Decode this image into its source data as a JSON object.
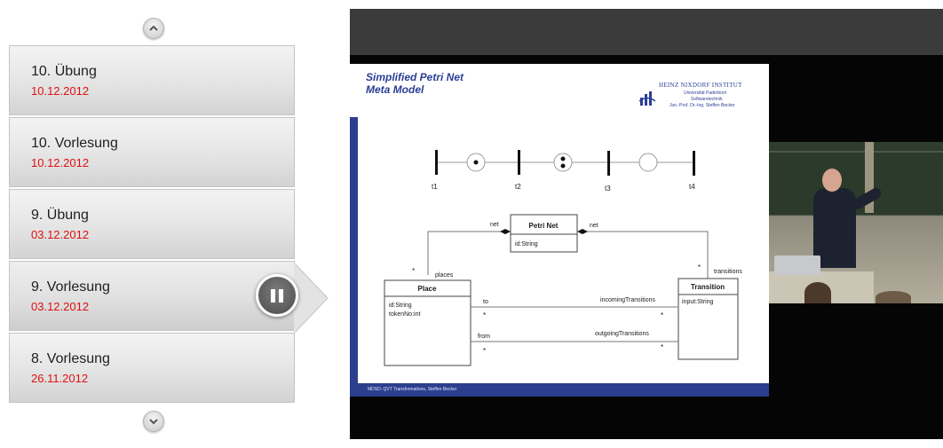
{
  "playlist": {
    "items": [
      {
        "title": "10. Übung",
        "date": "10.12.2012",
        "active": false
      },
      {
        "title": "10. Vorlesung",
        "date": "10.12.2012",
        "active": false
      },
      {
        "title": "9. Übung",
        "date": "03.12.2012",
        "active": false
      },
      {
        "title": "9. Vorlesung",
        "date": "03.12.2012",
        "active": true
      },
      {
        "title": "8. Vorlesung",
        "date": "26.11.2012",
        "active": false
      }
    ]
  },
  "slide": {
    "title_line1": "Simplified Petri Net",
    "title_line2": "Meta Model",
    "institute": "HEINZ NIXDORF INSTITUT",
    "university": "Universität Paderborn",
    "group": "Softwaretechnik",
    "professor": "Jun.-Prof. Dr.-Ing. Steffen Becker",
    "footer": "MDSD: QVT Transformations, Steffen Becker",
    "petri_labels": {
      "t1": "t1",
      "t2": "t2",
      "t3": "t3",
      "t4": "t4"
    },
    "uml": {
      "petri_net_class": "Petri Net",
      "petri_net_attr": "id:String",
      "place_class": "Place",
      "place_attrs": [
        "id:String",
        "tokenNo:int"
      ],
      "transition_class": "Transition",
      "transition_attr": "input:String",
      "net_left": "net",
      "net_right": "net",
      "places": "places",
      "transitions": "transitions",
      "to": "to",
      "from": "from",
      "incoming": "incomingTransitions",
      "outgoing": "outgoingTransitions",
      "star": "*"
    }
  },
  "colors": {
    "date_red": "#e01010",
    "slide_blue": "#2b3f94"
  },
  "icons": {
    "scroll_up": "chevron-up-icon",
    "scroll_down": "chevron-down-icon",
    "pause": "pause-icon"
  }
}
